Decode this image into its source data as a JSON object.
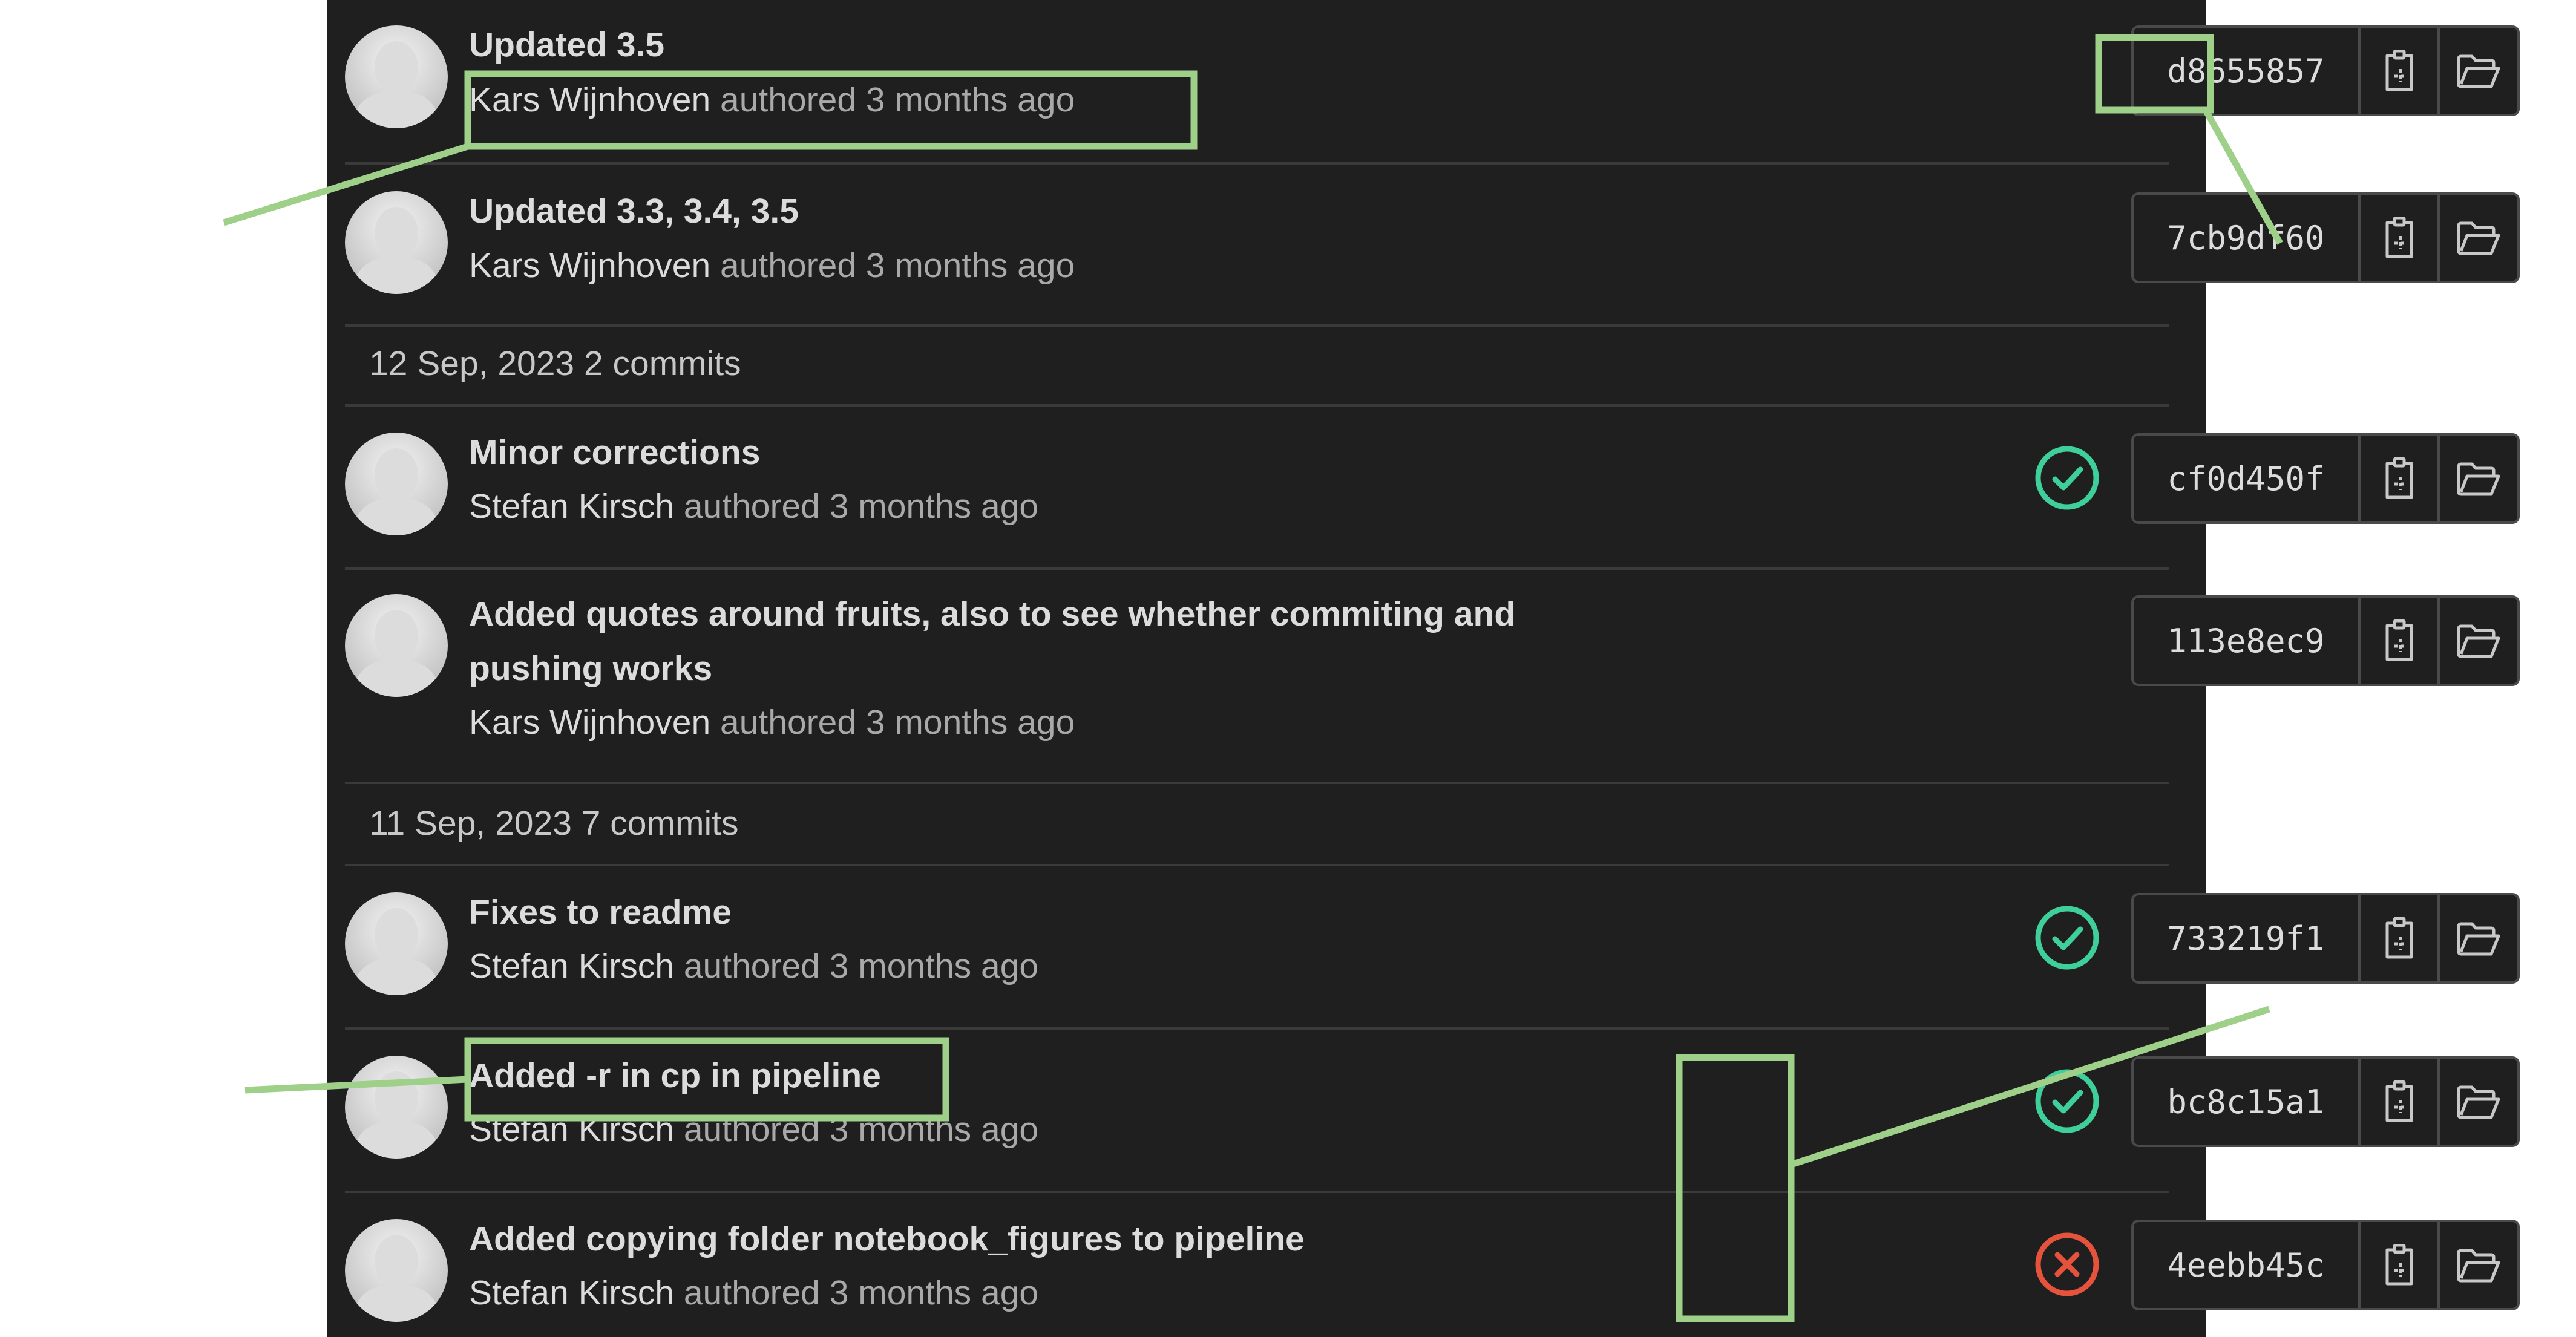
{
  "commits_list": {
    "top_partial": {
      "title": "Updated 3.5",
      "author": "Kars Wijnhoven",
      "meta": "authored 3 months ago",
      "sha": "d8655857"
    },
    "row2": {
      "title": "Updated 3.3, 3.4, 3.5",
      "author": "Kars Wijnhoven",
      "meta": "authored 3 months ago",
      "sha": "7cb9df60"
    },
    "group1": {
      "header": "12 Sep, 2023 2 commits",
      "row1": {
        "title": "Minor corrections",
        "author": "Stefan Kirsch",
        "meta": "authored 3 months ago",
        "sha": "cf0d450f",
        "status": "passed"
      },
      "row2": {
        "title_line1": "Added quotes around fruits, also to see whether commiting and",
        "title_line2": "pushing works",
        "author": "Kars Wijnhoven",
        "meta": "authored 3 months ago",
        "sha": "113e8ec9"
      }
    },
    "group2": {
      "header": "11 Sep, 2023 7 commits",
      "row1": {
        "title": "Fixes to readme",
        "author": "Stefan Kirsch",
        "meta": "authored 3 months ago",
        "sha": "733219f1",
        "status": "passed"
      },
      "row2": {
        "title": "Added -r in cp in pipeline",
        "author": "Stefan Kirsch",
        "meta": "authored 3 months ago",
        "sha": "bc8c15a1",
        "status": "passed"
      },
      "row3": {
        "title": "Added copying folder notebook_figures to pipeline",
        "author": "Stefan Kirsch",
        "meta": "authored 3 months ago",
        "sha": "4eebb45c",
        "status": "failed"
      }
    }
  },
  "icons": {
    "copy": "clipboard-icon",
    "browse": "folder-icon",
    "passed": "check-circle-icon",
    "failed": "x-circle-icon",
    "avatar": "default-avatar"
  },
  "colors": {
    "panel_bg": "#1f1f1f",
    "divider": "#3a3a3a",
    "status_passed": "#3ecf9a",
    "status_failed": "#e5533d",
    "annotation": "#9fd08a"
  }
}
